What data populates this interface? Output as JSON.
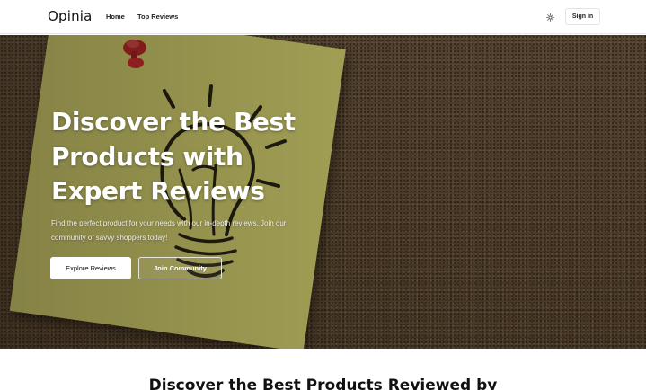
{
  "header": {
    "logo": "Opinia",
    "nav": [
      {
        "label": "Home"
      },
      {
        "label": "Top Reviews"
      }
    ],
    "theme_icon": "sun-icon",
    "signin_label": "Sign in"
  },
  "hero": {
    "title": "Discover the Best Products with Expert Reviews",
    "subtitle": "Find the perfect product for your needs with our in-depth reviews. Join our community of savvy shoppers today!",
    "primary_button": "Explore Reviews",
    "secondary_button": "Join Community",
    "background": "cork board with yellow sticky note and light bulb drawing"
  },
  "section": {
    "title": "Discover the Best Products Reviewed by"
  },
  "colors": {
    "header_bg": "#ffffff",
    "hero_overlay": "#3b2c1e",
    "note": "#c9c86a",
    "pin": "#c8262a"
  }
}
